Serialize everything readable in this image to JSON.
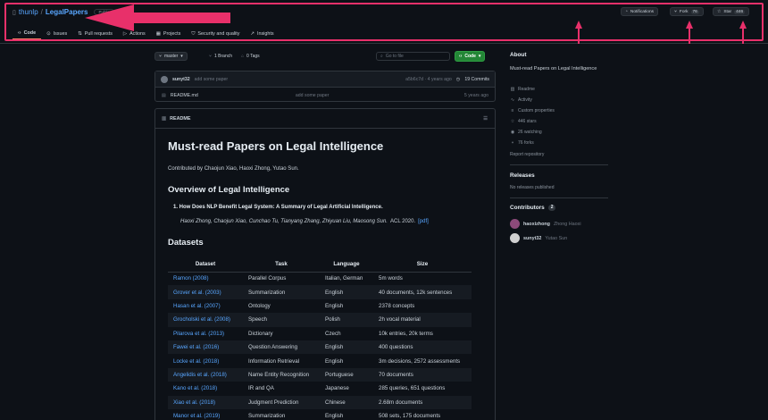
{
  "repo": {
    "owner": "thunlp",
    "separator": "/",
    "name": "LegalPapers",
    "visibility": "Public"
  },
  "header_buttons": {
    "notifications": "Notifications",
    "fork_label": "Fork",
    "fork_count": "76",
    "star_label": "Star",
    "star_count": "446"
  },
  "tabs": [
    "Code",
    "Issues",
    "Pull requests",
    "Actions",
    "Projects",
    "Security and quality",
    "Insights"
  ],
  "branch_bar": {
    "branch": "master",
    "branches": "1 Branch",
    "tags": "0 Tags",
    "search_placeholder": "Go to file",
    "code_button": "Code"
  },
  "commit": {
    "author": "sunyt32",
    "message": "add some paper",
    "hash": "a5b6c7d · 4 years ago",
    "commits": "19 Commits"
  },
  "files": [
    {
      "name": "README.md",
      "message": "add some paper",
      "time": "5 years ago"
    }
  ],
  "readme": {
    "tab_label": "README",
    "title": "Must-read Papers on Legal Intelligence",
    "contributors_line": "Contributed by Chaojun Xiao, Haoxi Zhong, Yutao Sun.",
    "overview_heading": "Overview of Legal Intelligence",
    "paper_title": "1. How Does NLP Benefit Legal System: A Summary of Legal Artificial Intelligence.",
    "paper_authors": "Haoxi Zhong, Chaojun Xiao, Cunchao Tu, Tianyang Zhang, Zhiyuan Liu, Maosong Sun.",
    "paper_venue": "ACL 2020.",
    "paper_link": "[pdf]",
    "datasets_heading": "Datasets"
  },
  "datasets_table": {
    "headers": [
      "Dataset",
      "Task",
      "Language",
      "Size"
    ],
    "rows": [
      [
        "Ramon (2008)",
        "Parallel Corpus",
        "Italian, German",
        "5m words"
      ],
      [
        "Grover et al. (2003)",
        "Summarization",
        "English",
        "40 documents, 12k sentences"
      ],
      [
        "Hasan et al. (2007)",
        "Ontology",
        "English",
        "2378 concepts"
      ],
      [
        "Grocholski et al. (2008)",
        "Speech",
        "Polish",
        "2h vocal material"
      ],
      [
        "Pilarova et al. (2013)",
        "Dictionary",
        "Czech",
        "10k entries, 20k terms"
      ],
      [
        "Fawei et al. (2016)",
        "Question Answering",
        "English",
        "400 questions"
      ],
      [
        "Locke et al. (2018)",
        "Information Retrieval",
        "English",
        "3m decisions, 2572 assessments"
      ],
      [
        "Angelidis et al. (2018)",
        "Name Entity Recognition",
        "Portuguese",
        "70 documents"
      ],
      [
        "Kano et al. (2018)",
        "IR and QA",
        "Japanese",
        "285 queries, 651 questions"
      ],
      [
        "Xiao et al. (2018)",
        "Judgment Prediction",
        "Chinese",
        "2.68m documents"
      ],
      [
        "Manor et al. (2019)",
        "Summarization",
        "English",
        "508 sets, 175 documents"
      ]
    ]
  },
  "about": {
    "heading": "About",
    "description": "Must-read Papers on Legal Intelligence",
    "items": [
      "Readme",
      "Activity",
      "Custom properties",
      "446 stars",
      "26 watching",
      "76 forks"
    ],
    "report": "Report repository"
  },
  "releases": {
    "heading": "Releases",
    "text": "No releases published"
  },
  "contributors": {
    "heading": "Contributors",
    "count": "2",
    "people": [
      {
        "login": "haoxizhong",
        "name": "Zhong Haoxi"
      },
      {
        "login": "sunyt32",
        "name": "Yutao Sun"
      }
    ]
  },
  "colors": {
    "annotation": "#e8306a",
    "accent": "#58a6ff",
    "green": "#238636",
    "active_tab": "#f78166"
  }
}
